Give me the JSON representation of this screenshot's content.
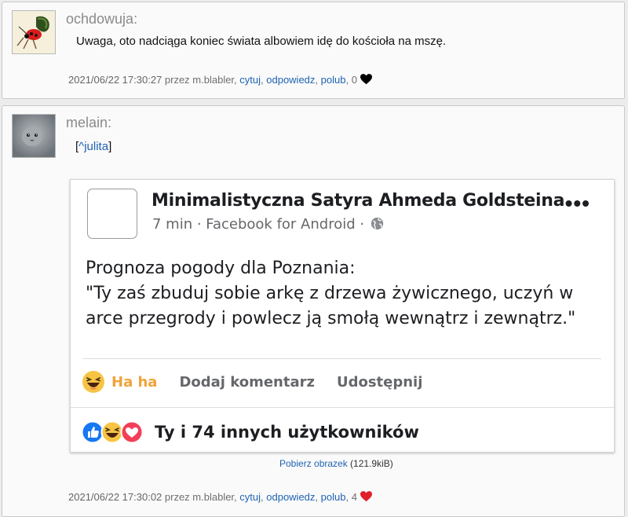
{
  "post1": {
    "username": "ochdowuja:",
    "message": "Uwaga, oto nadciąga koniec świata albowiem idę do kościoła na mszę.",
    "footer": {
      "timestamp": "2021/06/22 17:30:27",
      "by": " przez m.blabler",
      "quote": "cytuj",
      "reply": "odpowiedz",
      "like": "polub",
      "like_count": " 0",
      "heart_color": "#000000"
    }
  },
  "post2": {
    "username": "melain:",
    "reply_open": "[",
    "reply_link": "^julita",
    "reply_close": "]",
    "embed": {
      "page_name": "Minimalistyczna Satyra Ahmeda Goldsteina",
      "meta": "7 min · Facebook for Android ·",
      "menu": "•••",
      "text_line1": "Prognoza pogody dla Poznania:",
      "text_line2": "\"Ty zaś zbuduj sobie arkę z drzewa żywicznego, uczyń w",
      "text_line3": "arce przegrody i powlecz ją smołą wewnątrz i zewnątrz.\"",
      "action_haha": "Ha ha",
      "action_comment": "Dodaj komentarz",
      "action_share": "Udostępnij",
      "reactions_text": "Ty i 74 innych użytkowników",
      "colors": {
        "haha": "#f0a33a",
        "like": "#1877f2",
        "love": "#f33e58"
      }
    },
    "download": {
      "link": "Pobierz obrazek",
      "size": " (121.9kiB)"
    },
    "footer": {
      "timestamp": "2021/06/22 17:30:02",
      "by": " przez m.blabler",
      "quote": "cytuj",
      "reply": "odpowiedz",
      "like": "polub",
      "like_count": " 4",
      "heart_color": "#e0202a"
    }
  }
}
